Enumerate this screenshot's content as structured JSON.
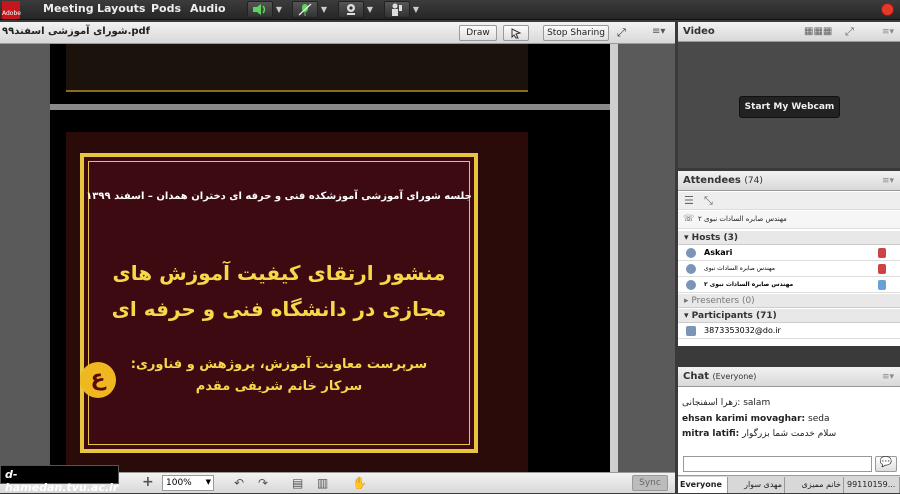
{
  "app": {
    "logo": "Adobe"
  },
  "menus": [
    "Meeting",
    "Layouts",
    "Pods",
    "Audio"
  ],
  "share_pod": {
    "title": "شورای آموزشی اسفند۹۹.pdf",
    "draw_label": "Draw",
    "stop_sharing_label": "Stop Sharing",
    "zoom_value": "100%",
    "sync_label": "Sync"
  },
  "slide": {
    "line1": "جلسه شورای آموزشی آموزشکده فنی و حرفه ای دختران همدان – اسفند ۱۳۹۹",
    "title_line1": "منشور ارتقای کیفیت آموزش های",
    "title_line2": "مجازی در دانشگاه فنی و حرفه ای",
    "subtitle1": "سرپرست معاونت آموزش، پروژهش و فناوری:",
    "subtitle2": "سرکار خانم شریفی مقدم",
    "logo": "ع"
  },
  "watermark": "d-hamedan.tvu.ac.ir",
  "video_pod": {
    "title": "Video",
    "webcam_button": "Start My Webcam"
  },
  "attendees_pod": {
    "title": "Attendees",
    "count": "(74)",
    "speaker": "مهندس صابره السادات نبوی ۲",
    "hosts_label": "Hosts (3)",
    "hosts": [
      "Askari",
      "مهندس صابره السادات نبوی",
      "مهندس صابره السادات نبوی ۲"
    ],
    "presenters_label": "Presenters (0)",
    "participants_label": "Participants (71)",
    "participants": [
      "3873353032@do.ir"
    ]
  },
  "chat_pod": {
    "title": "Chat",
    "scope": "(Everyone)",
    "messages": [
      {
        "from": "زهرا اسفنجانی:",
        "text": "salam"
      },
      {
        "from": "ehsan karimi movaghar:",
        "text": "seda"
      },
      {
        "from": "mitra latifi:",
        "text": "سلام خدمت شما بزرگوار"
      }
    ]
  },
  "bottom_tabs": [
    "Everyone",
    "مهدی سوار",
    "خانم ممیزی",
    "99110159..."
  ]
}
